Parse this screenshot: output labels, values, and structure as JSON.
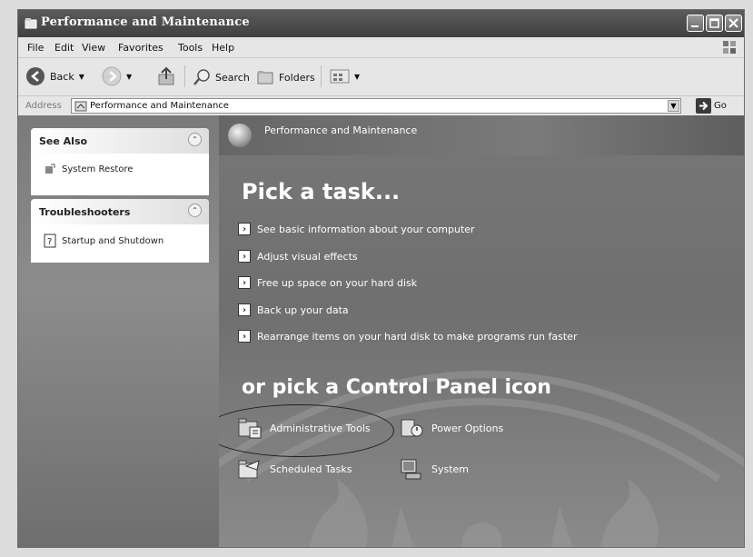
{
  "window": {
    "title": "Performance and Maintenance"
  },
  "menu": [
    "File",
    "Edit",
    "View",
    "Favorites",
    "Tools",
    "Help"
  ],
  "toolbar": {
    "back": "Back",
    "search": "Search",
    "folders": "Folders"
  },
  "address": {
    "label": "Address",
    "value": "Performance and Maintenance",
    "go": "Go"
  },
  "see_also": {
    "title": "See Also",
    "items": [
      "System Restore"
    ]
  },
  "troubleshooters": {
    "title": "Troubleshooters",
    "items": [
      "Startup and Shutdown"
    ]
  },
  "main": {
    "header": "Performance and Maintenance",
    "pick_task": "Pick a task...",
    "tasks": [
      "See basic information about your computer",
      "Adjust visual effects",
      "Free up space on your hard disk",
      "Back up your data",
      "Rearrange items on your hard disk to make programs run faster"
    ],
    "pick_icon": "or pick a Control Panel icon",
    "icons": [
      "Administrative Tools",
      "Power Options",
      "Scheduled Tasks",
      "System"
    ]
  }
}
